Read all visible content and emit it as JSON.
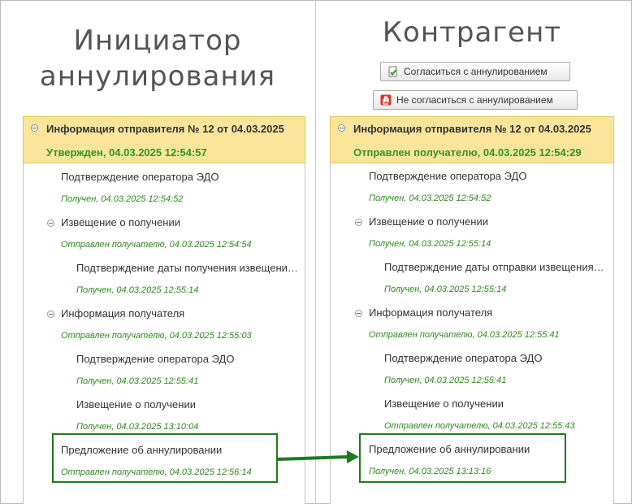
{
  "left": {
    "heading_line1": "Инициатор",
    "heading_line2": "аннулирования",
    "header_title": "Информация отправителя № 12 от 04.03.2025",
    "header_status": "Утвержден, 04.03.2025 12:54:57",
    "items": [
      {
        "label": "Подтверждение оператора ЭДО",
        "status": "Получен, 04.03.2025 12:54:52"
      },
      {
        "label": "Извещение о получении",
        "status": "Отправлен получателю, 04.03.2025 12:54:54"
      },
      {
        "label": "Подтверждение даты получения извещени…",
        "status": "Получен, 04.03.2025 12:55:14"
      },
      {
        "label": "Информация получателя",
        "status": "Отправлен получателю, 04.03.2025 12:55:03"
      },
      {
        "label": "Подтверждение оператора ЭДО",
        "status": "Получен, 04.03.2025 12:55:41"
      },
      {
        "label": "Извещение о получении",
        "status": "Получен, 04.03.2025 13:10:04"
      },
      {
        "label": "Предложение об аннулировании",
        "status": "Отправлен получателю, 04.03.2025 12:56:14"
      }
    ]
  },
  "right": {
    "heading": "Контрагент",
    "btn_agree": "Согласиться с аннулированием",
    "btn_disagree": "Не согласиться с аннулированием",
    "header_title": "Информация отправителя № 12 от 04.03.2025",
    "header_status": "Отправлен получателю, 04.03.2025 12:54:29",
    "items": [
      {
        "label": "Подтверждение оператора ЭДО",
        "status": "Получен, 04.03.2025 12:54:52"
      },
      {
        "label": "Извещение о получении",
        "status": "Получен, 04.03.2025 12:55:14"
      },
      {
        "label": "Подтверждение даты отправки извещения…",
        "status": "Получен, 04.03.2025 12:55:14"
      },
      {
        "label": "Информация получателя",
        "status": "Отправлен получателю, 04.03.2025 12:55:41"
      },
      {
        "label": "Подтверждение оператора ЭДО",
        "status": "Получен, 04.03.2025 12:55:41"
      },
      {
        "label": "Извещение о получении",
        "status": "Отправлен получателю, 04.03.2025 12:55:43"
      },
      {
        "label": "Предложение об аннулировании",
        "status": "Получен, 04.03.2025 13:13:16"
      }
    ]
  },
  "colors": {
    "header_bg": "#fbe59a",
    "status_green": "#2c9a1c",
    "highlight_green": "#1e7a1e"
  }
}
